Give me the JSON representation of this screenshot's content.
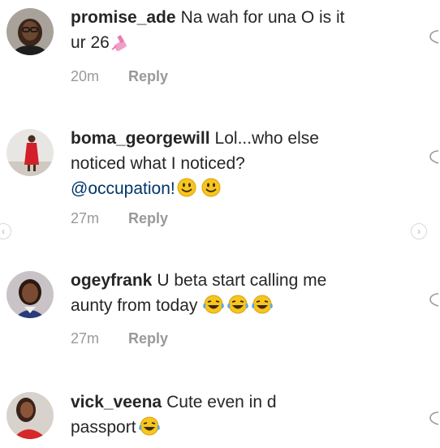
{
  "comments": [
    {
      "username": "promise_ade",
      "text_line1": "Na wah for una O is it",
      "text_line2": "ur 26",
      "time": "20m",
      "reply": "Reply"
    },
    {
      "username": "boma_georgewill",
      "text_line1": "Lol...who else",
      "text_line2": "noticed what I noticed?",
      "mention": "@occupation!",
      "time": "27m",
      "reply": "Reply"
    },
    {
      "username": "ogeyfrank",
      "text_line1": "U beta start calling me",
      "text_line2": "aunty from today",
      "time": "27m",
      "reply": "Reply"
    },
    {
      "username": "vick_veena",
      "text_line1": "Cute even in d",
      "text_line2": "passport"
    }
  ],
  "icons": {
    "like": "heart-icon",
    "prev": "chevron-left-icon",
    "next": "chevron-right-icon"
  },
  "colors": {
    "text": "#262626",
    "meta": "#999999",
    "mention": "#003569"
  }
}
